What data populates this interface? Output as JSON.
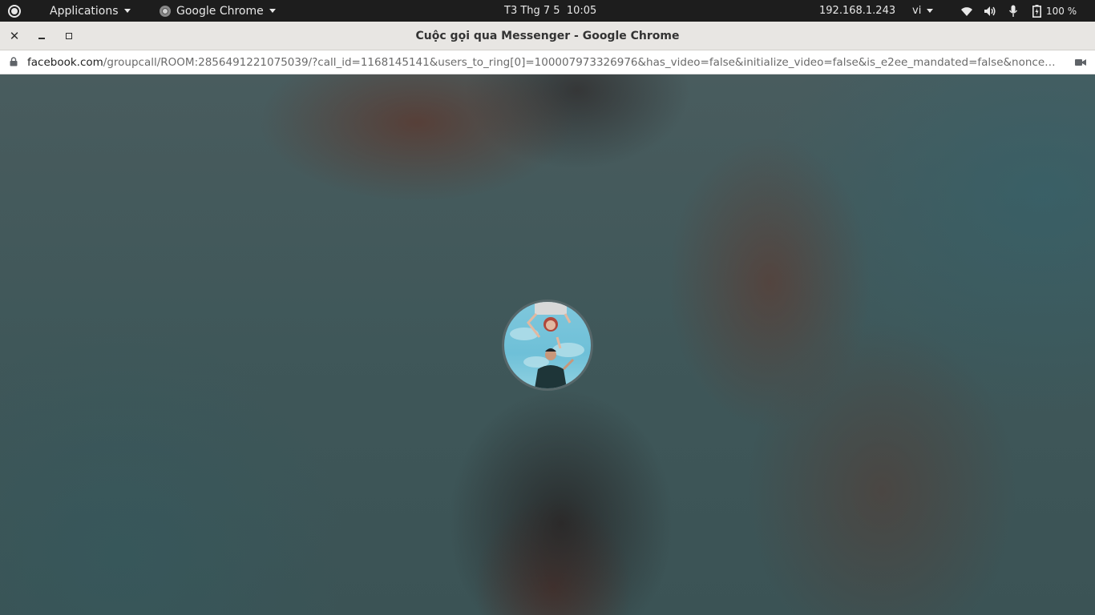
{
  "top_panel": {
    "applications_label": "Applications",
    "active_app_label": "Google Chrome",
    "clock": "T3 Thg 7 5  10:05",
    "ip_address": "192.168.1.243",
    "input_language": "vi",
    "battery_percent": "100 %",
    "icons": [
      "activities-icon",
      "chrome-icon",
      "wifi-icon",
      "volume-icon",
      "microphone-icon",
      "battery-icon"
    ]
  },
  "window": {
    "title": "Cuộc gọi qua Messenger - Google Chrome",
    "controls": [
      "close-icon",
      "minimize-icon",
      "maximize-icon"
    ]
  },
  "address_bar": {
    "host": "facebook.com",
    "path": "/groupcall/ROOM:2856491221075039/?call_id=1168145141&users_to_ring[0]=100007973326976&has_video=false&initialize_video=false&is_e2ee_mandated=false&nonce=dvc7fbqp633a...",
    "icons": [
      "lock-icon",
      "camera-icon"
    ]
  },
  "call": {
    "avatar_icon": "profile-photo",
    "colors": {
      "background": "#42585b",
      "ring": "#5a696c"
    }
  }
}
